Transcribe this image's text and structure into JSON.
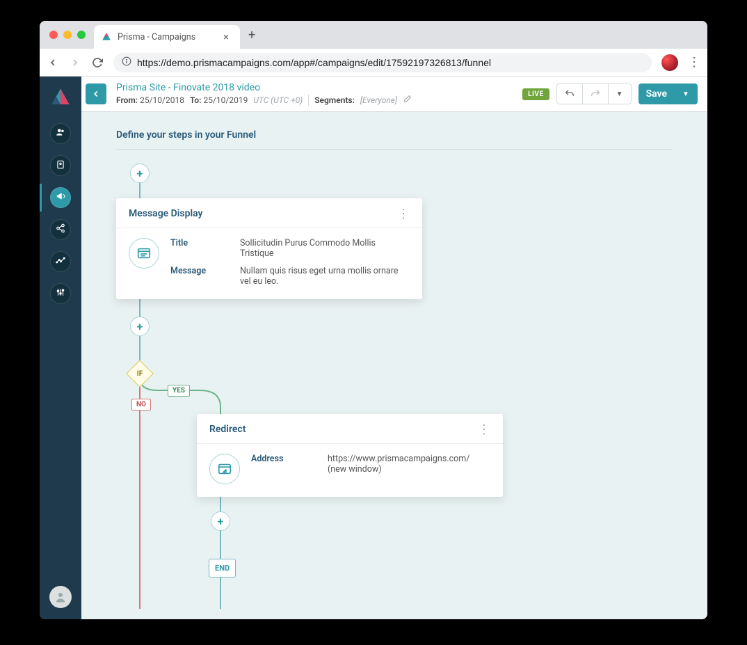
{
  "browser": {
    "tab_title": "Prisma - Campaigns",
    "url": "https://demo.prismacampaigns.com/app#/campaigns/edit/17592197326813/funnel"
  },
  "header": {
    "breadcrumb": "Prisma Site - Finovate 2018 video",
    "from_label": "From:",
    "from_value": "25/10/2018",
    "to_label": "To:",
    "to_value": "25/10/2019",
    "timezone": "UTC (UTC +0)",
    "segments_label": "Segments:",
    "segments_value": "[Everyone]",
    "status_badge": "LIVE",
    "save_label": "Save"
  },
  "section": {
    "title": "Define your steps in your Funnel"
  },
  "flow": {
    "if_label": "IF",
    "yes_label": "YES",
    "no_label": "NO",
    "end_label": "END",
    "plus": "+"
  },
  "card_message": {
    "title": "Message Display",
    "field_title_label": "Title",
    "field_title_value": "Sollicitudin Purus Commodo Mollis Tristique",
    "field_message_label": "Message",
    "field_message_value": "Nullam quis risus eget urna mollis ornare vel eu leo."
  },
  "card_redirect": {
    "title": "Redirect",
    "field_address_label": "Address",
    "field_address_value": "https://www.prismacampaigns.com/ (new window)"
  }
}
